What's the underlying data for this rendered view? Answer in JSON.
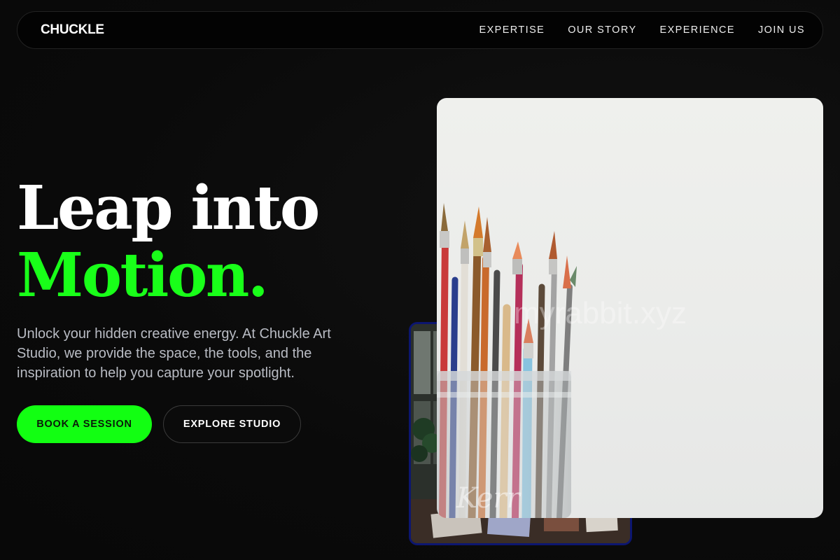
{
  "nav": {
    "brand": "CHUCKLE",
    "links": [
      "EXPERTISE",
      "OUR STORY",
      "EXPERIENCE",
      "JOIN US"
    ]
  },
  "hero": {
    "title_line1": "Leap into",
    "title_line2": "Motion.",
    "description": "Unlock your hidden creative energy. At Chuckle Art Studio, we provide the space, the tools, and the inspiration to help you capture your spotlight.",
    "primary_cta": "BOOK A SESSION",
    "secondary_cta": "EXPLORE STUDIO"
  },
  "images": {
    "main_watermark": "myrabbit.xyz",
    "jar_lettering": "Kerr"
  },
  "colors": {
    "background": "#0a0a0a",
    "accent_green": "#12ff12",
    "title_green": "#19ff19",
    "body_text": "#b9bcc4",
    "secondary_photo_border": "#0c1670"
  }
}
